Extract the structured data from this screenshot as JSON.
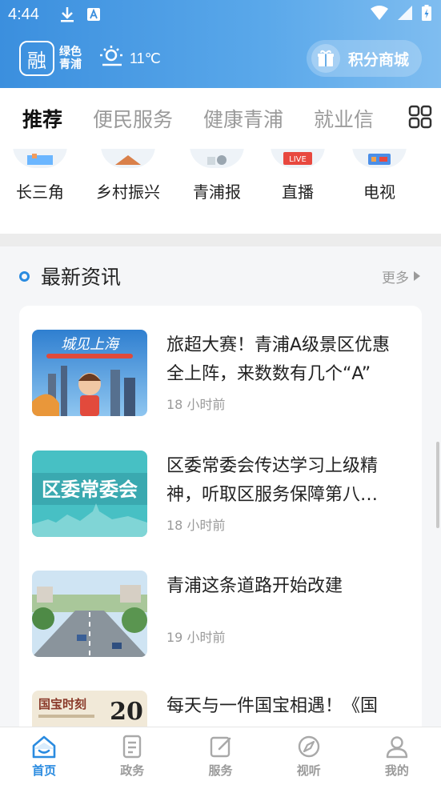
{
  "status_bar": {
    "time": "4:44"
  },
  "header": {
    "logo_line1": "绿色",
    "logo_line2": "青浦",
    "temperature": "11℃",
    "mall_label": "积分商城"
  },
  "tabs": [
    {
      "label": "推荐"
    },
    {
      "label": "便民服务"
    },
    {
      "label": "健康青浦"
    },
    {
      "label": "就业信"
    }
  ],
  "shortcuts": [
    {
      "label": "长三角"
    },
    {
      "label": "乡村振兴"
    },
    {
      "label": "青浦报"
    },
    {
      "label": "直播"
    },
    {
      "label": "电视"
    }
  ],
  "news_section": {
    "title": "最新资讯",
    "more_label": "更多",
    "items": [
      {
        "title": "旅超大赛！青浦A级景区优惠全上阵，来数数有几个“A”",
        "time": "18 小时前",
        "thumb_text": "城见上海"
      },
      {
        "title": "区委常委会传达学习上级精神，听取区服务保障第八…",
        "time": "18 小时前",
        "thumb_text": "区委常委会"
      },
      {
        "title": "青浦这条道路开始改建",
        "time": "19 小时前"
      },
      {
        "title": "每天与一件国宝相遇！《国",
        "time": "",
        "thumb_text": "国宝时刻",
        "thumb_num": "20"
      }
    ]
  },
  "live_badge": "LIVE",
  "bottom_nav": [
    {
      "label": "首页"
    },
    {
      "label": "政务"
    },
    {
      "label": "服务"
    },
    {
      "label": "视听"
    },
    {
      "label": "我的"
    }
  ],
  "colors": {
    "primary": "#2a8be0",
    "header_start": "#3b8fde",
    "header_end": "#7fbdf0"
  }
}
